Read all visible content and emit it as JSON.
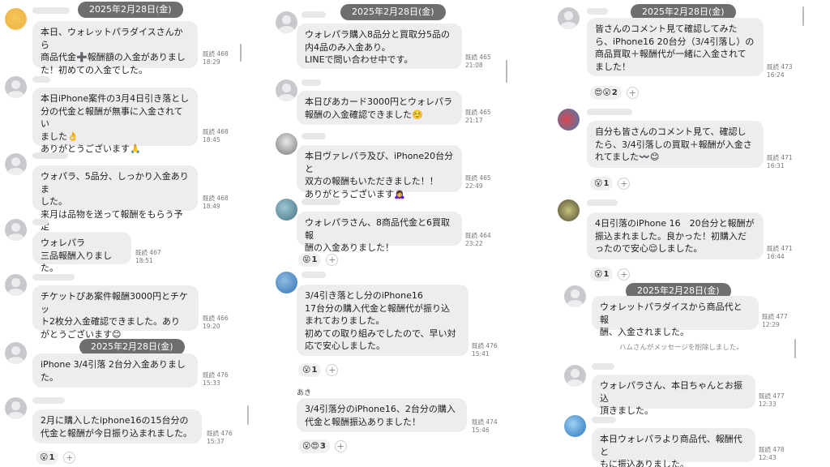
{
  "col1": {
    "date1": "2025年2月28日(金)",
    "date2": "2025年2月28日(金)",
    "m1": {
      "text": "本日、ウォレットパラダイスさんから\n商品代金➕報酬額の入金がありまし\nた！初めての入金でした。",
      "read": "既読 468",
      "time": "18:29"
    },
    "m2": {
      "text": "本日iPhone案件の3月4日引き落とし\n分の代金と報酬が無事に入金されてい\nました👌\nありがとうございます🙏",
      "read": "既読 468",
      "time": "18:45"
    },
    "m3": {
      "text": "ウォパラ、5品分、しっかり入金ありま\nした。\n来月は品物を送って報酬をもらう予定",
      "read": "既読 468",
      "time": "18:49"
    },
    "m4": {
      "text": "ウォレパラ\n三品報酬入りました。",
      "read": "既読 467",
      "time": "18:51"
    },
    "m5": {
      "text": "チケットぴあ案件報酬3000円とチケッ\nト2枚分入金確認できました。あり\nがとうございます😊",
      "read": "既読 466",
      "time": "19:20"
    },
    "m6": {
      "text": "iPhone 3/4引落 2台分入金ありまし\nた。",
      "read": "既読 476",
      "time": "15:33"
    },
    "m7": {
      "text": "2月に購入したiphone16の15台分の\n代金と報酬が今日振り込まれました。",
      "read": "既読 476",
      "time": "15:37"
    },
    "r7": {
      "emoji": "😮",
      "count": "1",
      "plus": "+"
    }
  },
  "col2": {
    "date1": "2025年2月28日(金)",
    "m1": {
      "text": "ウォレパラ購入8品分と買取分5品の\n内4品のみ入金あり。\nLINEで問い合わせ中です。",
      "read": "既読 465",
      "time": "21:08"
    },
    "m2": {
      "text": "本日ぴあカード3000円とウォレパラ\n報酬の入金確認できました☺️",
      "read": "既読 465",
      "time": "21:17"
    },
    "m3": {
      "text": "本日ヴァレパラ及び、iPhone20台分と\n双方の報酬もいただきました！！\nありがとうございます🙇‍♀️",
      "read": "既読 465",
      "time": "22:49"
    },
    "m4": {
      "text": "ウォレパラさん、8商品代金と6買取報\n酬の入金ありました！",
      "read": "既読 464",
      "time": "23:22"
    },
    "r4": {
      "emoji": "😝",
      "count": "1",
      "plus": "+"
    },
    "m5": {
      "text": "3/4引き落とし分のiPhone16\n17台分の購入代金と報酬代が振り込\nまれておりました。\n初めての取り組みでしたので、早い対\n応で安心しました。",
      "read": "既読 476",
      "time": "15:41"
    },
    "r5": {
      "emoji": "😮",
      "count": "1",
      "plus": "+"
    },
    "sender6": "あき",
    "m6": {
      "text": "3/4引落分のiPhone16、2台分の購入\n代金と報酬振込ありました！",
      "read": "既読 474",
      "time": "15:46"
    },
    "r6": {
      "emoji": "😮😍",
      "count": "3",
      "plus": "+"
    }
  },
  "col3": {
    "date1": "2025年2月28日(金)",
    "m1": {
      "text": "皆さんのコメント見て確認してみた\nら、iPhone16 20台分（3/4引落し）の\n商品買取＋報酬代が一緒に入金されて\nました！",
      "read": "既読 473",
      "time": "16:24"
    },
    "r1": {
      "emoji": "😍😮",
      "count": "2",
      "plus": "+"
    },
    "m2": {
      "text": "自分も皆さんのコメント見て、確認し\nたら、3/4引落しの買取＋報酬が入金さ\nれてました〰️😊",
      "read": "既読 471",
      "time": "16:31"
    },
    "r2": {
      "emoji": "😮",
      "count": "1",
      "plus": "+"
    },
    "m3": {
      "text": "4日引落のiPhone 16　20台分と報酬が\n振込まれました。良かった！初購入だ\nったので安心😌しました。",
      "read": "既読 471",
      "time": "16:44"
    },
    "r3": {
      "emoji": "😮",
      "count": "1",
      "plus": "+"
    },
    "date2": "2025年2月28日(金)",
    "m4": {
      "text": "ウォレットパラダイスから商品代と報\n酬、入金されました。",
      "read": "既読 477",
      "time": "12:29"
    },
    "sys": "ハムさんがメッセージを削除しました。",
    "m5": {
      "text": "ウォレパラさん、本日ちゃんとお振込\n頂きました。",
      "read": "既読 477",
      "time": "12:33"
    },
    "m6": {
      "text": "本日ウォレパラより商品代、報酬代と\nもに振込ありました。",
      "read": "既読 478",
      "time": "12:43"
    }
  }
}
